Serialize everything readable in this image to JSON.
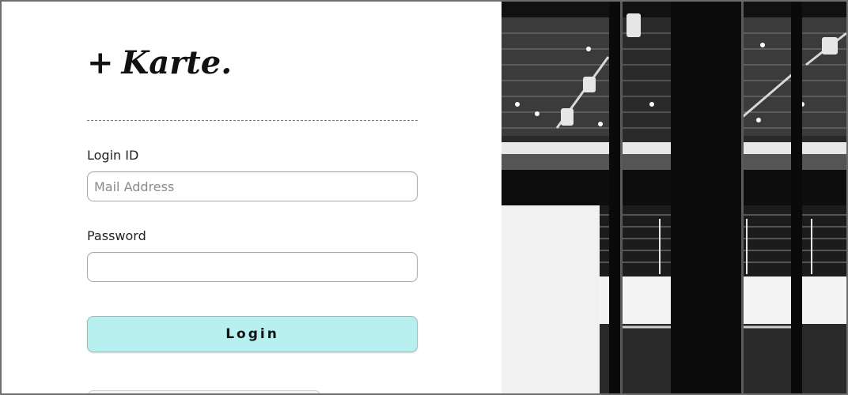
{
  "brand": {
    "plus": "+",
    "name": "Karte."
  },
  "form": {
    "login_label": "Login ID",
    "login_placeholder": "Mail Address",
    "login_value": "",
    "password_label": "Password",
    "password_value": "",
    "login_button": "Login"
  },
  "image": {
    "description": "black-and-white architectural photo",
    "style": "monochrome"
  },
  "colors": {
    "login_button_bg": "#b8f0f0",
    "frame_border": "#6e6e6e"
  }
}
